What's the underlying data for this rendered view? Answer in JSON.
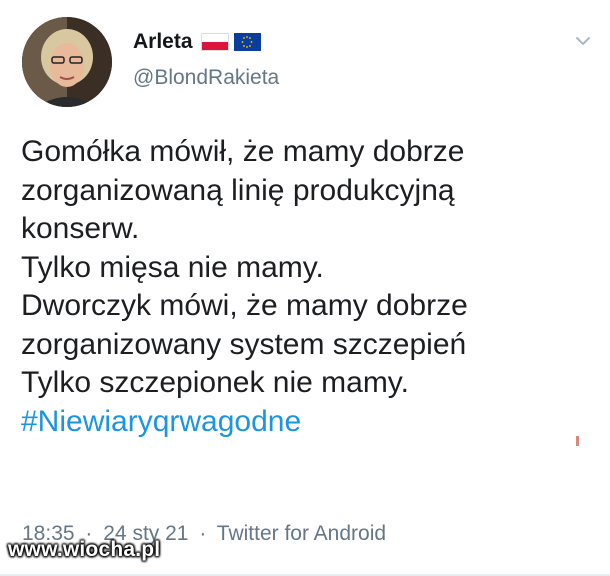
{
  "user": {
    "display_name": "Arleta",
    "handle": "@BlondRakieta"
  },
  "tweet": {
    "lines": [
      "Gomółka mówił, że mamy dobrze",
      "zorganizowaną linię produkcyjną",
      "konserw.",
      "Tylko mięsa nie mamy.",
      "Dworczyk mówi, że mamy dobrze",
      "zorganizowany system szczepień",
      "Tylko szczepionek nie mamy."
    ],
    "hashtag": "#Niewiaryqrwagodne"
  },
  "meta": {
    "time": "18:35",
    "date_sep": "·",
    "date": "24 sty 21",
    "source_sep": "·",
    "source": "Twitter for Android"
  },
  "watermark": "www.wiocha.pl",
  "icons": {
    "caret": "chevron-down-icon",
    "flag_pl": "poland-flag-icon",
    "flag_eu": "eu-flag-icon"
  },
  "colors": {
    "link": "#1b95e0",
    "muted": "#657786",
    "text": "#1c1e21"
  }
}
